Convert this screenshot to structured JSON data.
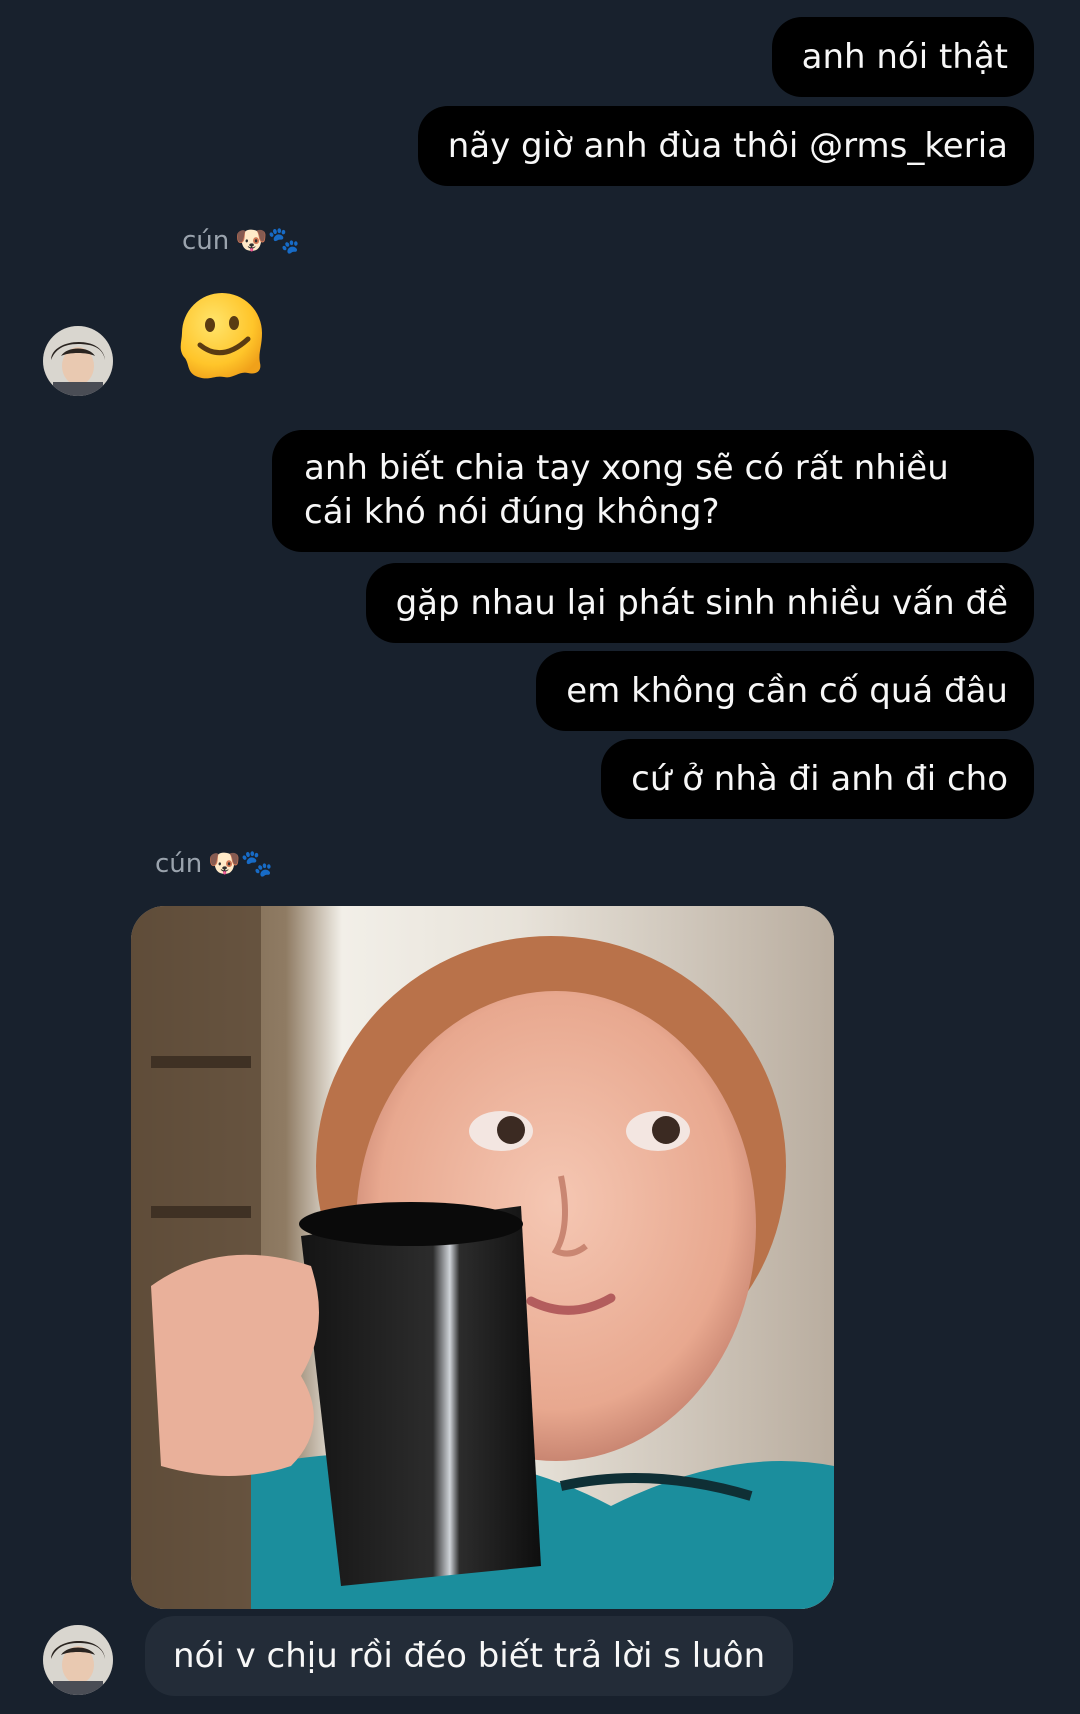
{
  "conversation": {
    "messages_out_1": [
      "anh nói thật",
      "nãy giờ anh đùa thôi @rms_keria"
    ],
    "sender_name": "cún",
    "sender_emoji": "🐶🐾",
    "reaction_emoji": "melting-face",
    "messages_out_2": [
      "anh biết chia tay xong sẽ có rất nhiều cái khó nói đúng không?",
      "gặp nhau lại phát sinh nhiều vấn đề",
      "em không cần cố quá đâu",
      "cứ ở nhà đi anh đi cho"
    ],
    "incoming_text": "nói v chịu rồi đéo biết trả lời s luôn",
    "photo_description": "meme-kid-drinking-from-mug"
  }
}
